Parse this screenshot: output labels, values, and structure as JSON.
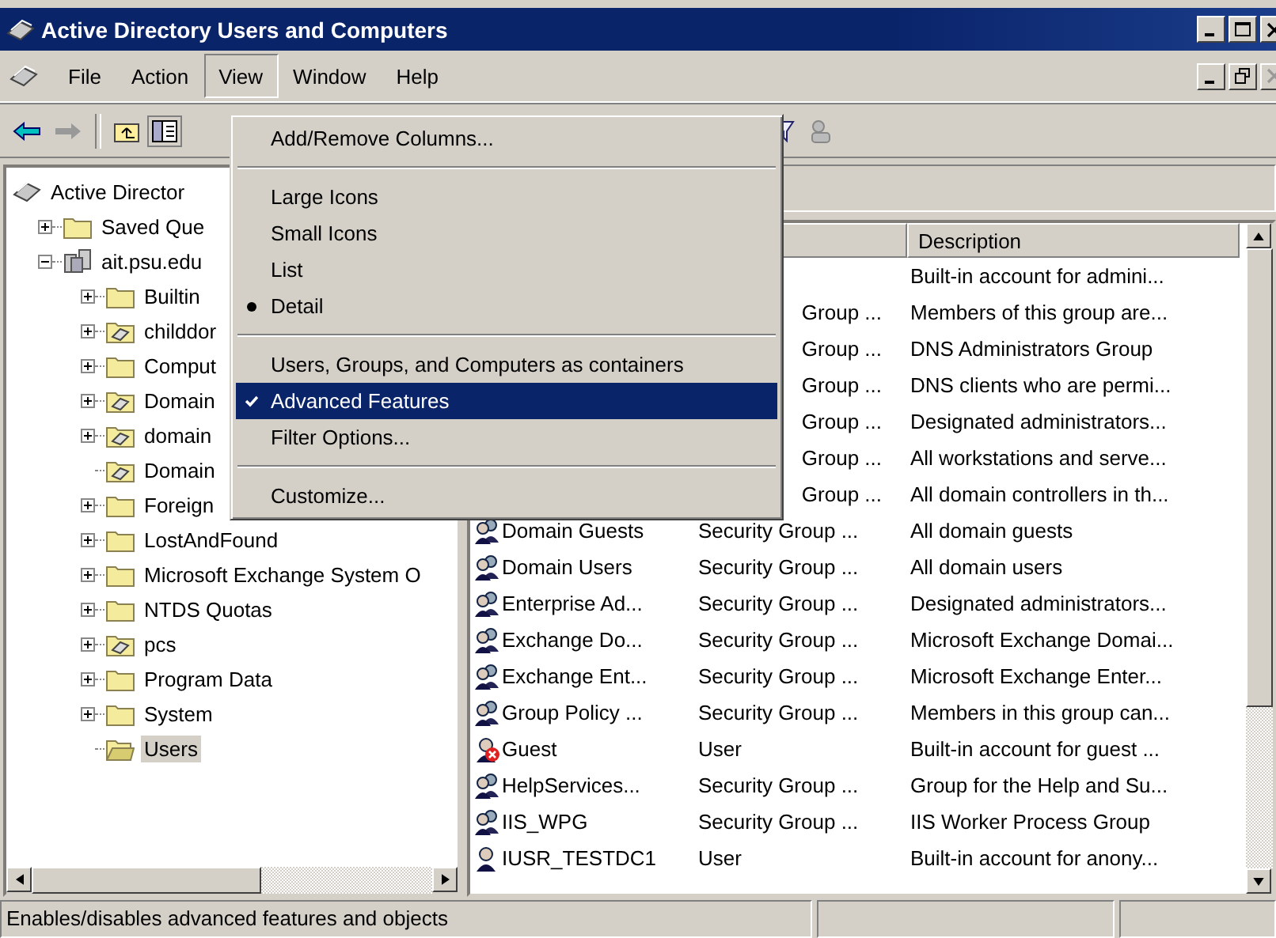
{
  "window": {
    "title": "Active Directory Users and Computers"
  },
  "menu_bar": [
    {
      "label": "File",
      "selected": false
    },
    {
      "label": "Action",
      "selected": false
    },
    {
      "label": "View",
      "selected": true
    },
    {
      "label": "Window",
      "selected": false
    },
    {
      "label": "Help",
      "selected": false
    }
  ],
  "view_menu": [
    {
      "kind": "item",
      "label": "Add/Remove Columns...",
      "selected": false
    },
    {
      "kind": "separator"
    },
    {
      "kind": "radio",
      "label": "Large Icons",
      "checked": false,
      "selected": false
    },
    {
      "kind": "radio",
      "label": "Small Icons",
      "checked": false,
      "selected": false
    },
    {
      "kind": "radio",
      "label": "List",
      "checked": false,
      "selected": false
    },
    {
      "kind": "radio",
      "label": "Detail",
      "checked": true,
      "selected": false
    },
    {
      "kind": "separator"
    },
    {
      "kind": "check",
      "label": "Users, Groups, and Computers as containers",
      "checked": false,
      "selected": false
    },
    {
      "kind": "check",
      "label": "Advanced Features",
      "checked": true,
      "selected": true
    },
    {
      "kind": "item",
      "label": "Filter Options...",
      "selected": false
    },
    {
      "kind": "separator"
    },
    {
      "kind": "item",
      "label": "Customize...",
      "selected": false
    }
  ],
  "tree": [
    {
      "label": "Active Director",
      "kind": "root",
      "selected": false,
      "children": [
        {
          "label": "Saved Que",
          "kind": "folder",
          "expanded": false,
          "selected": false
        },
        {
          "label": "ait.psu.edu",
          "kind": "domain",
          "expanded": true,
          "selected": false,
          "children": [
            {
              "label": "Builtin",
              "kind": "folder",
              "expanded": false,
              "selected": false
            },
            {
              "label": "childdor",
              "kind": "ou",
              "expanded": false,
              "selected": false
            },
            {
              "label": "Comput",
              "kind": "folder",
              "expanded": false,
              "selected": false
            },
            {
              "label": "Domain",
              "kind": "ou",
              "expanded": false,
              "selected": false
            },
            {
              "label": "domain",
              "kind": "ou",
              "expanded": false,
              "selected": false
            },
            {
              "label": "Domain",
              "kind": "ou",
              "selected": false
            },
            {
              "label": "Foreign",
              "kind": "folder",
              "expanded": false,
              "selected": false
            },
            {
              "label": "LostAndFound",
              "kind": "folder",
              "expanded": false,
              "selected": false
            },
            {
              "label": "Microsoft Exchange System O",
              "kind": "folder",
              "expanded": false,
              "selected": false
            },
            {
              "label": "NTDS Quotas",
              "kind": "folder",
              "expanded": false,
              "selected": false
            },
            {
              "label": "pcs",
              "kind": "ou",
              "expanded": false,
              "selected": false
            },
            {
              "label": "Program Data",
              "kind": "folder",
              "expanded": false,
              "selected": false
            },
            {
              "label": "System",
              "kind": "folder",
              "expanded": false,
              "selected": false
            },
            {
              "label": "Users",
              "kind": "folder-open",
              "selected": true
            }
          ]
        }
      ]
    }
  ],
  "list": {
    "columns": [
      "Description"
    ],
    "rows": [
      {
        "description": "Built-in account for admini..."
      },
      {
        "type": "Group ...",
        "description": "Members of this group are..."
      },
      {
        "type": "Group ...",
        "description": "DNS Administrators Group"
      },
      {
        "type": "Group ...",
        "description": "DNS clients who are permi..."
      },
      {
        "type": "Group ...",
        "description": "Designated administrators..."
      },
      {
        "type": "Group ...",
        "description": "All workstations and serve..."
      },
      {
        "type": "Group ...",
        "description": "All domain controllers in th..."
      },
      {
        "kind": "group",
        "name": "Domain Guests",
        "type": "Security Group ...",
        "description": "All domain guests"
      },
      {
        "kind": "group",
        "name": "Domain Users",
        "type": "Security Group ...",
        "description": "All domain users"
      },
      {
        "kind": "group",
        "name": "Enterprise Ad...",
        "type": "Security Group ...",
        "description": "Designated administrators..."
      },
      {
        "kind": "group",
        "name": "Exchange Do...",
        "type": "Security Group ...",
        "description": "Microsoft Exchange Domai..."
      },
      {
        "kind": "group",
        "name": "Exchange Ent...",
        "type": "Security Group ...",
        "description": "Microsoft Exchange Enter..."
      },
      {
        "kind": "group",
        "name": "Group Policy ...",
        "type": "Security Group ...",
        "description": "Members in this group can..."
      },
      {
        "kind": "user-disabled",
        "name": "Guest",
        "type": "User",
        "description": "Built-in account for guest ..."
      },
      {
        "kind": "group",
        "name": "HelpServices...",
        "type": "Security Group ...",
        "description": "Group for the Help and Su..."
      },
      {
        "kind": "group",
        "name": "IIS_WPG",
        "type": "Security Group ...",
        "description": "IIS Worker Process Group"
      },
      {
        "kind": "user",
        "name": "IUSR_TESTDC1",
        "type": "User",
        "description": "Built-in account for anony..."
      }
    ]
  },
  "status_bar": {
    "text": "Enables/disables advanced features and objects"
  }
}
